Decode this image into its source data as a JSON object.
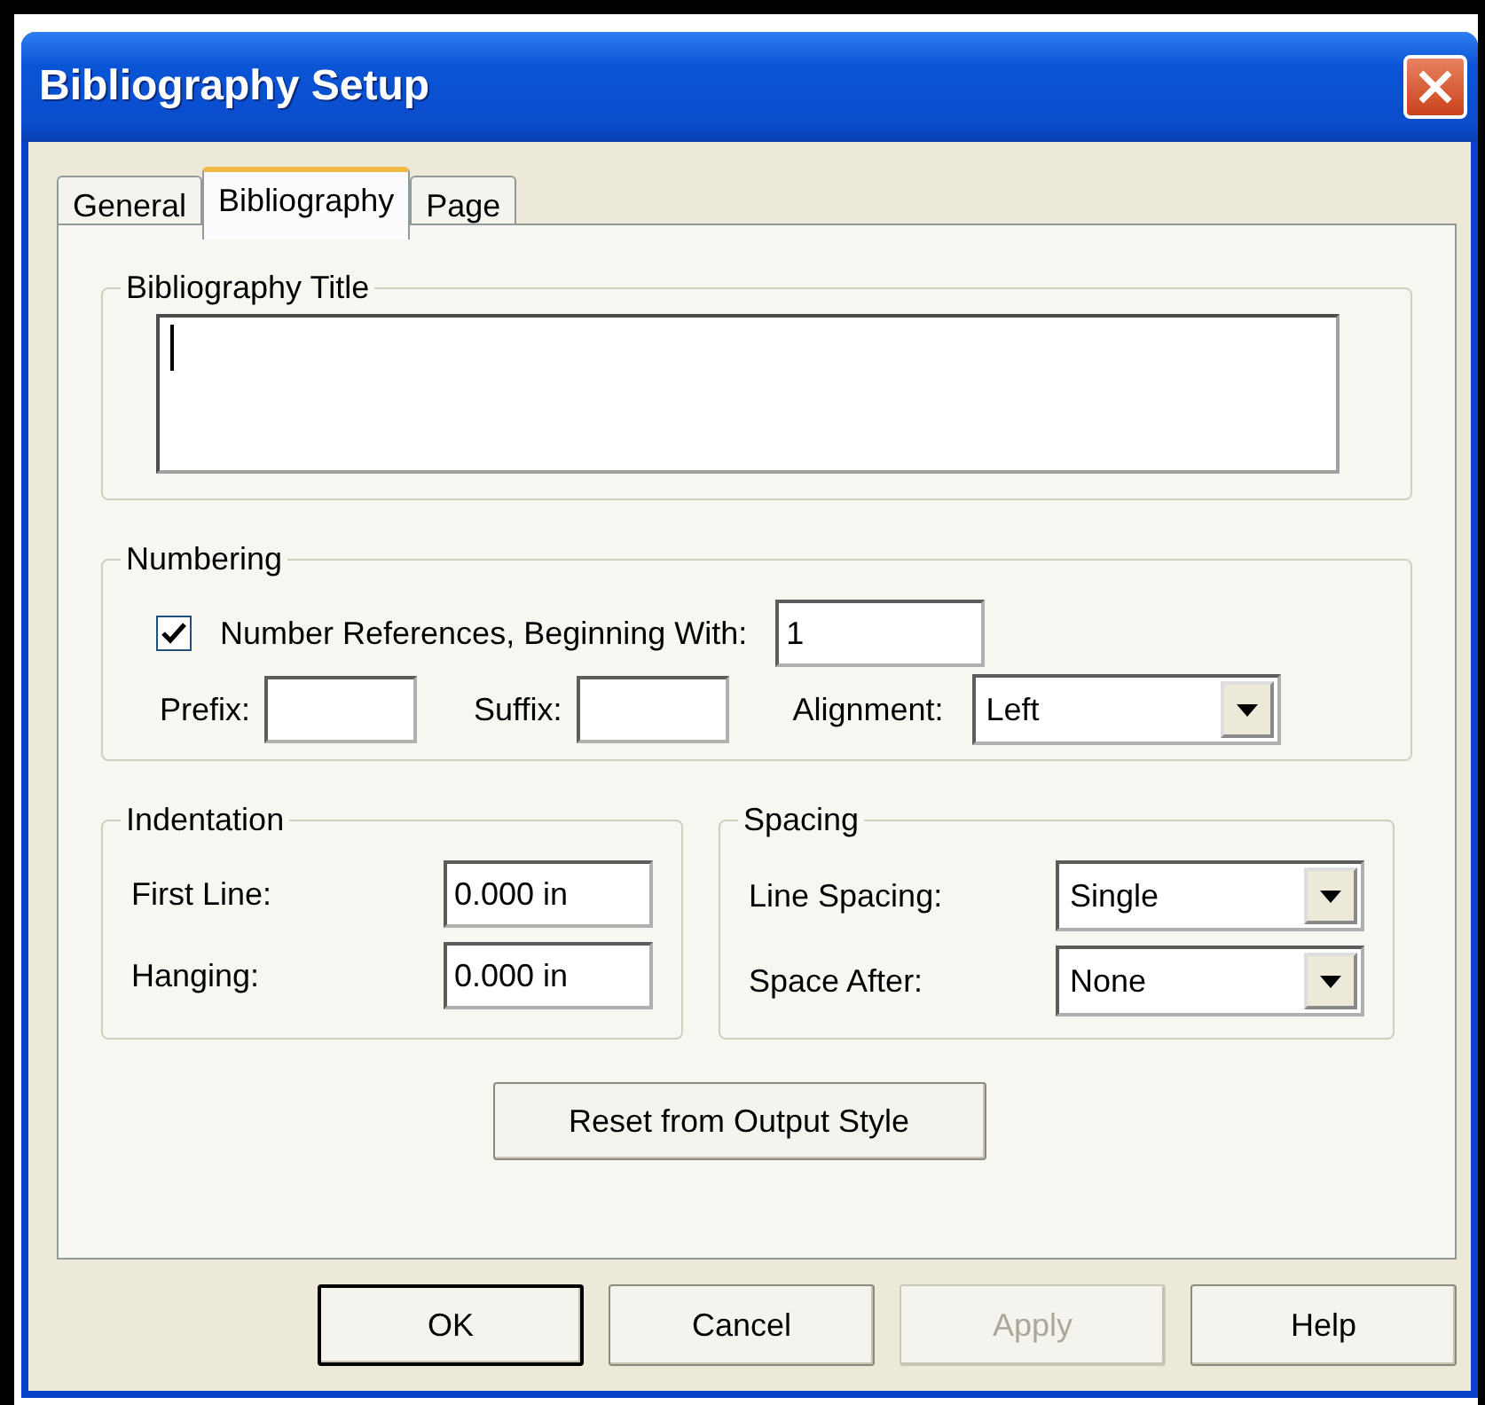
{
  "window": {
    "title": "Bibliography Setup"
  },
  "tabs": [
    {
      "label": "General",
      "selected": false
    },
    {
      "label": "Bibliography",
      "selected": true
    },
    {
      "label": "Page",
      "selected": false
    }
  ],
  "title_group": {
    "label": "Bibliography Title"
  },
  "numbering": {
    "label": "Numbering",
    "checkbox": {
      "label": "Number References, Beginning With:",
      "checked": true
    },
    "start": {
      "value": "1"
    },
    "prefix": {
      "label": "Prefix:"
    },
    "suffix": {
      "label": "Suffix:"
    },
    "alignment": {
      "label": "Alignment:",
      "value": "Left"
    }
  },
  "indentation": {
    "label": "Indentation",
    "fields": [
      {
        "label": "First Line:",
        "value": "0.000 in"
      },
      {
        "label": "Hanging:",
        "value": "0.000 in"
      }
    ]
  },
  "spacing": {
    "label": "Spacing",
    "fields": [
      {
        "label": "Line Spacing:",
        "value": "Single"
      },
      {
        "label": "Space After:",
        "value": "None"
      }
    ]
  },
  "reset_button": {
    "label": "Reset from Output Style"
  },
  "buttons": [
    {
      "label": "OK",
      "default": true,
      "disabled": false
    },
    {
      "label": "Cancel",
      "default": false,
      "disabled": false
    },
    {
      "label": "Apply",
      "default": false,
      "disabled": true
    },
    {
      "label": "Help",
      "default": false,
      "disabled": false
    }
  ]
}
